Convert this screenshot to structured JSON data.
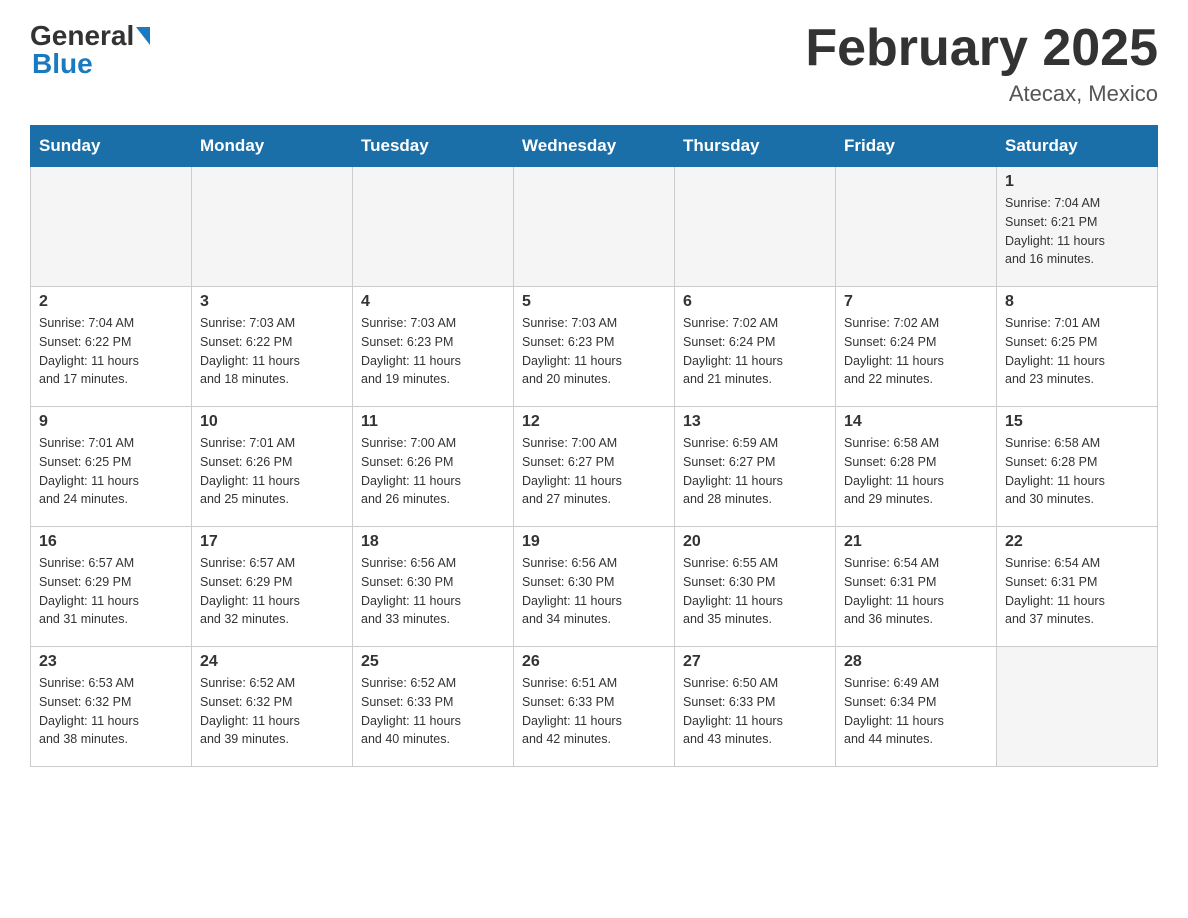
{
  "header": {
    "logo": {
      "general": "General",
      "blue": "Blue"
    },
    "title": "February 2025",
    "subtitle": "Atecax, Mexico"
  },
  "weekdays": [
    "Sunday",
    "Monday",
    "Tuesday",
    "Wednesday",
    "Thursday",
    "Friday",
    "Saturday"
  ],
  "weeks": [
    [
      {
        "day": "",
        "info": ""
      },
      {
        "day": "",
        "info": ""
      },
      {
        "day": "",
        "info": ""
      },
      {
        "day": "",
        "info": ""
      },
      {
        "day": "",
        "info": ""
      },
      {
        "day": "",
        "info": ""
      },
      {
        "day": "1",
        "info": "Sunrise: 7:04 AM\nSunset: 6:21 PM\nDaylight: 11 hours\nand 16 minutes."
      }
    ],
    [
      {
        "day": "2",
        "info": "Sunrise: 7:04 AM\nSunset: 6:22 PM\nDaylight: 11 hours\nand 17 minutes."
      },
      {
        "day": "3",
        "info": "Sunrise: 7:03 AM\nSunset: 6:22 PM\nDaylight: 11 hours\nand 18 minutes."
      },
      {
        "day": "4",
        "info": "Sunrise: 7:03 AM\nSunset: 6:23 PM\nDaylight: 11 hours\nand 19 minutes."
      },
      {
        "day": "5",
        "info": "Sunrise: 7:03 AM\nSunset: 6:23 PM\nDaylight: 11 hours\nand 20 minutes."
      },
      {
        "day": "6",
        "info": "Sunrise: 7:02 AM\nSunset: 6:24 PM\nDaylight: 11 hours\nand 21 minutes."
      },
      {
        "day": "7",
        "info": "Sunrise: 7:02 AM\nSunset: 6:24 PM\nDaylight: 11 hours\nand 22 minutes."
      },
      {
        "day": "8",
        "info": "Sunrise: 7:01 AM\nSunset: 6:25 PM\nDaylight: 11 hours\nand 23 minutes."
      }
    ],
    [
      {
        "day": "9",
        "info": "Sunrise: 7:01 AM\nSunset: 6:25 PM\nDaylight: 11 hours\nand 24 minutes."
      },
      {
        "day": "10",
        "info": "Sunrise: 7:01 AM\nSunset: 6:26 PM\nDaylight: 11 hours\nand 25 minutes."
      },
      {
        "day": "11",
        "info": "Sunrise: 7:00 AM\nSunset: 6:26 PM\nDaylight: 11 hours\nand 26 minutes."
      },
      {
        "day": "12",
        "info": "Sunrise: 7:00 AM\nSunset: 6:27 PM\nDaylight: 11 hours\nand 27 minutes."
      },
      {
        "day": "13",
        "info": "Sunrise: 6:59 AM\nSunset: 6:27 PM\nDaylight: 11 hours\nand 28 minutes."
      },
      {
        "day": "14",
        "info": "Sunrise: 6:58 AM\nSunset: 6:28 PM\nDaylight: 11 hours\nand 29 minutes."
      },
      {
        "day": "15",
        "info": "Sunrise: 6:58 AM\nSunset: 6:28 PM\nDaylight: 11 hours\nand 30 minutes."
      }
    ],
    [
      {
        "day": "16",
        "info": "Sunrise: 6:57 AM\nSunset: 6:29 PM\nDaylight: 11 hours\nand 31 minutes."
      },
      {
        "day": "17",
        "info": "Sunrise: 6:57 AM\nSunset: 6:29 PM\nDaylight: 11 hours\nand 32 minutes."
      },
      {
        "day": "18",
        "info": "Sunrise: 6:56 AM\nSunset: 6:30 PM\nDaylight: 11 hours\nand 33 minutes."
      },
      {
        "day": "19",
        "info": "Sunrise: 6:56 AM\nSunset: 6:30 PM\nDaylight: 11 hours\nand 34 minutes."
      },
      {
        "day": "20",
        "info": "Sunrise: 6:55 AM\nSunset: 6:30 PM\nDaylight: 11 hours\nand 35 minutes."
      },
      {
        "day": "21",
        "info": "Sunrise: 6:54 AM\nSunset: 6:31 PM\nDaylight: 11 hours\nand 36 minutes."
      },
      {
        "day": "22",
        "info": "Sunrise: 6:54 AM\nSunset: 6:31 PM\nDaylight: 11 hours\nand 37 minutes."
      }
    ],
    [
      {
        "day": "23",
        "info": "Sunrise: 6:53 AM\nSunset: 6:32 PM\nDaylight: 11 hours\nand 38 minutes."
      },
      {
        "day": "24",
        "info": "Sunrise: 6:52 AM\nSunset: 6:32 PM\nDaylight: 11 hours\nand 39 minutes."
      },
      {
        "day": "25",
        "info": "Sunrise: 6:52 AM\nSunset: 6:33 PM\nDaylight: 11 hours\nand 40 minutes."
      },
      {
        "day": "26",
        "info": "Sunrise: 6:51 AM\nSunset: 6:33 PM\nDaylight: 11 hours\nand 42 minutes."
      },
      {
        "day": "27",
        "info": "Sunrise: 6:50 AM\nSunset: 6:33 PM\nDaylight: 11 hours\nand 43 minutes."
      },
      {
        "day": "28",
        "info": "Sunrise: 6:49 AM\nSunset: 6:34 PM\nDaylight: 11 hours\nand 44 minutes."
      },
      {
        "day": "",
        "info": ""
      }
    ]
  ]
}
